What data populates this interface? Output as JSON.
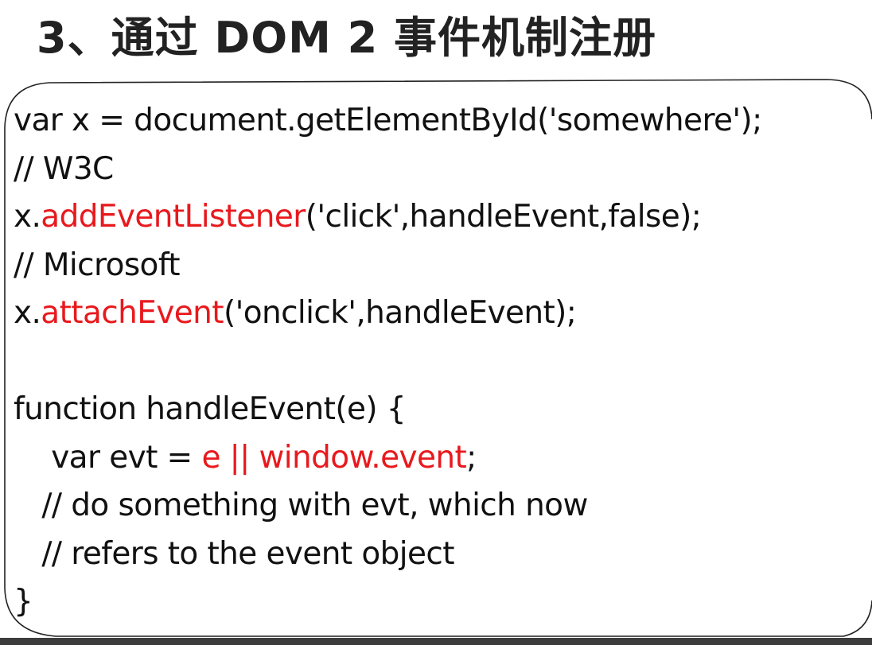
{
  "slide": {
    "title": "3、通过 DOM 2 事件机制注册"
  },
  "colors": {
    "text": "#111111",
    "highlight": "#e8191d",
    "bottom_bar": "#3c3c3c"
  },
  "code": {
    "lines": [
      {
        "segments": [
          {
            "text": "var x = document.getElementById('somewhere');"
          }
        ]
      },
      {
        "segments": [
          {
            "text": "// W3C"
          }
        ]
      },
      {
        "segments": [
          {
            "text": "x."
          },
          {
            "text": "addEventListener",
            "highlight": true
          },
          {
            "text": "('click',handleEvent,false);"
          }
        ]
      },
      {
        "segments": [
          {
            "text": "// Microsoft"
          }
        ]
      },
      {
        "segments": [
          {
            "text": "x."
          },
          {
            "text": "attachEvent",
            "highlight": true
          },
          {
            "text": "('onclick',handleEvent);"
          }
        ]
      },
      {
        "segments": [
          {
            "text": ""
          }
        ]
      },
      {
        "segments": [
          {
            "text": "function handleEvent(e) {"
          }
        ]
      },
      {
        "segments": [
          {
            "text": "    var evt = "
          },
          {
            "text": "e || window.event",
            "highlight": true
          },
          {
            "text": ";"
          }
        ]
      },
      {
        "segments": [
          {
            "text": "   // do something with evt, which now"
          }
        ]
      },
      {
        "segments": [
          {
            "text": "   // refers to the event object"
          }
        ]
      },
      {
        "segments": [
          {
            "text": "}"
          }
        ]
      }
    ]
  }
}
